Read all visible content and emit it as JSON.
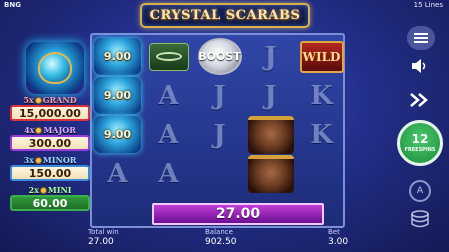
{
  "header": {
    "provider": "BNG",
    "title": "CRYSTAL SCARABS",
    "lines": "15 Lines"
  },
  "jackpots": [
    {
      "multiplier": "5x",
      "name": "GRAND",
      "value": "15,000.00"
    },
    {
      "multiplier": "4x",
      "name": "MAJOR",
      "value": "300.00"
    },
    {
      "multiplier": "3x",
      "name": "MINOR",
      "value": "150.00"
    },
    {
      "multiplier": "2x",
      "name": "MINI",
      "value": "60.00"
    }
  ],
  "reels": {
    "scarab_values": [
      "9.00",
      "9.00",
      "9.00"
    ],
    "boost_label": "BOOST",
    "wild_label": "WILD",
    "letters": {
      "r1c2": "A",
      "r1c3": "J",
      "r1c5": "K",
      "r2c2": "J",
      "r2c3": "J",
      "r2c5": "K",
      "r3c2": "A",
      "r3c3": "J",
      "r4c1": "A",
      "r4c3": "A"
    }
  },
  "win_display": "27.00",
  "bottom": {
    "total_win_label": "Total win",
    "total_win_value": "27.00",
    "balance_label": "Balance",
    "balance_value": "902.50",
    "bet_label": "Bet",
    "bet_value": "3.00"
  },
  "controls": {
    "freespins_count": "12",
    "freespins_label": "FREESPINS",
    "auto_label": "A"
  },
  "colors": {
    "background": "#232f8a",
    "win_bar": "#9c28c0",
    "spin_button": "#2aa84d",
    "jackpot_gold": "#d9a23a"
  }
}
